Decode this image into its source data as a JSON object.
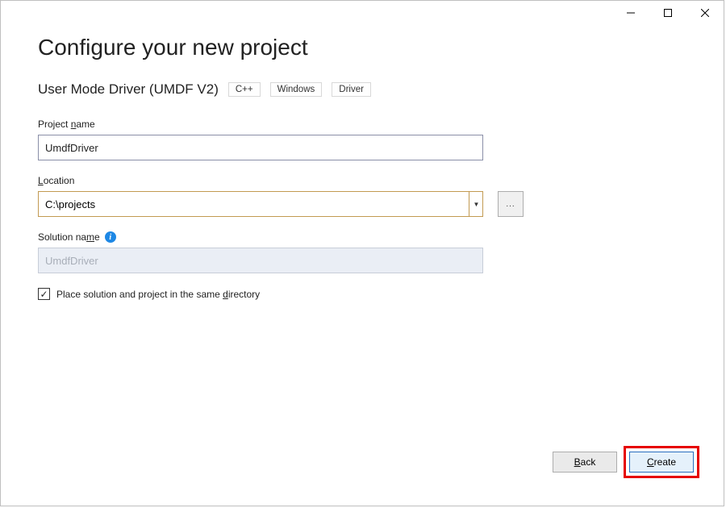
{
  "window": {
    "title": "Configure your new project"
  },
  "template": {
    "name": "User Mode Driver (UMDF V2)",
    "tags": [
      "C++",
      "Windows",
      "Driver"
    ]
  },
  "fields": {
    "projectName": {
      "label_pre": "Project ",
      "label_u": "n",
      "label_post": "ame",
      "value": "UmdfDriver"
    },
    "location": {
      "label_u": "L",
      "label_post": "ocation",
      "value": "C:\\projects",
      "browse": "..."
    },
    "solutionName": {
      "label_pre": "Solution na",
      "label_u": "m",
      "label_post": "e",
      "placeholder": "UmdfDriver"
    },
    "sameDir": {
      "checked": "✓",
      "label_pre": "Place solution and project in the same ",
      "label_u": "d",
      "label_post": "irectory"
    }
  },
  "buttons": {
    "back_u": "B",
    "back_post": "ack",
    "create_u": "C",
    "create_post": "reate"
  }
}
